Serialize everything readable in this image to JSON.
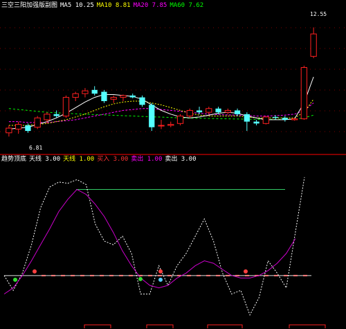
{
  "top_header": {
    "title": "三空三阳加强版副图",
    "items": [
      {
        "text": "MA5 10.25",
        "color": "#ffffff"
      },
      {
        "text": "MA10 8.81",
        "color": "#ffff00"
      },
      {
        "text": "MA20 7.85",
        "color": "#ff00ff"
      },
      {
        "text": "MA60 7.62",
        "color": "#00ff00"
      }
    ]
  },
  "price_labels": {
    "high": "12.55",
    "low": "6.81"
  },
  "bottom_header": {
    "title": "趋势顶底",
    "items": [
      {
        "text": "天线 3.00",
        "color": "#ffffff"
      },
      {
        "text": "天线 1.00",
        "color": "#ffff00"
      },
      {
        "text": "买入 3.00",
        "color": "#ff3333"
      },
      {
        "text": "卖出 1.00",
        "color": "#ff00ff"
      },
      {
        "text": "卖出 3.00",
        "color": "#ffffff"
      }
    ]
  },
  "colors": {
    "up": "#ff2020",
    "down": "#54ffff",
    "ma5": "#ffffff",
    "ma10": "#ffff00",
    "ma20": "#ff00ff",
    "ma60": "#00ff00",
    "grid": "#800000"
  },
  "chart_data": [
    {
      "type": "candlestick",
      "title": "",
      "ylim": [
        6.0,
        13.5
      ],
      "candles": [
        {
          "o": 6.9,
          "h": 7.3,
          "l": 6.7,
          "c": 7.15
        },
        {
          "o": 7.1,
          "h": 7.5,
          "l": 6.85,
          "c": 7.35
        },
        {
          "o": 7.3,
          "h": 7.4,
          "l": 6.9,
          "c": 7.0
        },
        {
          "o": 7.2,
          "h": 7.8,
          "l": 7.1,
          "c": 7.7
        },
        {
          "o": 7.6,
          "h": 8.0,
          "l": 7.4,
          "c": 7.9
        },
        {
          "o": 7.9,
          "h": 8.1,
          "l": 7.7,
          "c": 7.8
        },
        {
          "o": 7.8,
          "h": 8.9,
          "l": 7.7,
          "c": 8.8
        },
        {
          "o": 8.8,
          "h": 9.1,
          "l": 8.6,
          "c": 9.0
        },
        {
          "o": 9.0,
          "h": 9.3,
          "l": 8.8,
          "c": 9.15
        },
        {
          "o": 9.2,
          "h": 9.4,
          "l": 8.9,
          "c": 9.0
        },
        {
          "o": 9.1,
          "h": 9.2,
          "l": 8.5,
          "c": 8.6
        },
        {
          "o": 8.7,
          "h": 8.9,
          "l": 8.5,
          "c": 8.8
        },
        {
          "o": 8.8,
          "h": 8.95,
          "l": 8.6,
          "c": 8.9
        },
        {
          "o": 8.9,
          "h": 9.0,
          "l": 8.75,
          "c": 8.8
        },
        {
          "o": 8.8,
          "h": 8.9,
          "l": 8.3,
          "c": 8.4
        },
        {
          "o": 8.4,
          "h": 8.5,
          "l": 7.0,
          "c": 7.2
        },
        {
          "o": 7.3,
          "h": 7.6,
          "l": 7.1,
          "c": 7.3
        },
        {
          "o": 7.3,
          "h": 7.5,
          "l": 7.2,
          "c": 7.35
        },
        {
          "o": 7.4,
          "h": 7.9,
          "l": 7.3,
          "c": 7.8
        },
        {
          "o": 7.8,
          "h": 8.2,
          "l": 7.7,
          "c": 8.1
        },
        {
          "o": 8.1,
          "h": 8.3,
          "l": 7.9,
          "c": 8.0
        },
        {
          "o": 8.0,
          "h": 8.3,
          "l": 7.9,
          "c": 8.2
        },
        {
          "o": 8.2,
          "h": 8.3,
          "l": 7.9,
          "c": 8.0
        },
        {
          "o": 8.0,
          "h": 8.2,
          "l": 7.9,
          "c": 8.1
        },
        {
          "o": 8.1,
          "h": 8.2,
          "l": 7.8,
          "c": 7.9
        },
        {
          "o": 7.9,
          "h": 8.0,
          "l": 7.0,
          "c": 7.5
        },
        {
          "o": 7.5,
          "h": 7.6,
          "l": 7.3,
          "c": 7.4
        },
        {
          "o": 7.4,
          "h": 7.8,
          "l": 7.35,
          "c": 7.75
        },
        {
          "o": 7.75,
          "h": 7.85,
          "l": 7.6,
          "c": 7.7
        },
        {
          "o": 7.7,
          "h": 7.8,
          "l": 7.5,
          "c": 7.6
        },
        {
          "o": 7.6,
          "h": 7.7,
          "l": 7.55,
          "c": 7.65
        },
        {
          "o": 7.65,
          "h": 10.5,
          "l": 7.6,
          "c": 10.4
        },
        {
          "o": 11.0,
          "h": 12.55,
          "l": 10.9,
          "c": 12.2
        }
      ],
      "ma5": [
        7.1,
        7.15,
        7.2,
        7.35,
        7.5,
        7.7,
        7.95,
        8.25,
        8.55,
        8.8,
        8.95,
        8.95,
        8.9,
        8.85,
        8.7,
        8.4,
        8.1,
        7.9,
        7.75,
        7.7,
        7.75,
        7.85,
        7.95,
        8.0,
        7.95,
        7.8,
        7.7,
        7.6,
        7.6,
        7.6,
        7.65,
        8.5,
        9.9
      ],
      "ma10": [
        7.3,
        7.3,
        7.3,
        7.35,
        7.4,
        7.5,
        7.6,
        7.75,
        7.9,
        8.1,
        8.3,
        8.45,
        8.55,
        8.6,
        8.6,
        8.5,
        8.4,
        8.25,
        8.1,
        7.95,
        7.85,
        7.8,
        7.8,
        7.8,
        7.8,
        7.75,
        7.7,
        7.7,
        7.7,
        7.7,
        7.7,
        8.0,
        8.7
      ],
      "ma20": [
        7.5,
        7.5,
        7.45,
        7.45,
        7.45,
        7.5,
        7.55,
        7.6,
        7.7,
        7.8,
        7.9,
        8.0,
        8.1,
        8.15,
        8.2,
        8.2,
        8.15,
        8.1,
        8.05,
        8.0,
        7.95,
        7.9,
        7.88,
        7.86,
        7.85,
        7.83,
        7.8,
        7.8,
        7.82,
        7.85,
        7.9,
        8.1,
        8.5
      ],
      "ma60": [
        8.2,
        8.15,
        8.1,
        8.05,
        8.0,
        7.97,
        7.95,
        7.92,
        7.9,
        7.88,
        7.86,
        7.84,
        7.82,
        7.8,
        7.78,
        7.76,
        7.74,
        7.72,
        7.7,
        7.69,
        7.68,
        7.67,
        7.66,
        7.65,
        7.64,
        7.63,
        7.62,
        7.62,
        7.62,
        7.62,
        7.63,
        7.7,
        7.85
      ]
    },
    {
      "type": "line",
      "title": "",
      "ylim": [
        -0.15,
        1.1
      ],
      "series": [
        {
          "values": [
            0.2,
            0.08,
            0.22,
            0.45,
            0.75,
            0.92,
            0.96,
            0.95,
            0.98,
            0.94,
            0.62,
            0.48,
            0.45,
            0.52,
            0.38,
            0.05,
            0.05,
            0.28,
            0.12,
            0.28,
            0.38,
            0.52,
            0.66,
            0.48,
            0.22,
            0.05,
            0.08,
            -0.12,
            0.02,
            0.32,
            0.22,
            0.1,
            0.55,
            1.0
          ]
        },
        {
          "values": [
            0.05,
            0.1,
            0.2,
            0.32,
            0.45,
            0.58,
            0.72,
            0.82,
            0.9,
            0.86,
            0.78,
            0.68,
            0.55,
            0.4,
            0.28,
            0.18,
            0.12,
            0.1,
            0.12,
            0.18,
            0.22,
            0.28,
            0.32,
            0.3,
            0.25,
            0.2,
            0.18,
            0.18,
            0.2,
            0.24,
            0.3,
            0.38,
            0.5
          ]
        }
      ],
      "reference_lines": [
        0.9,
        0.2
      ]
    }
  ]
}
